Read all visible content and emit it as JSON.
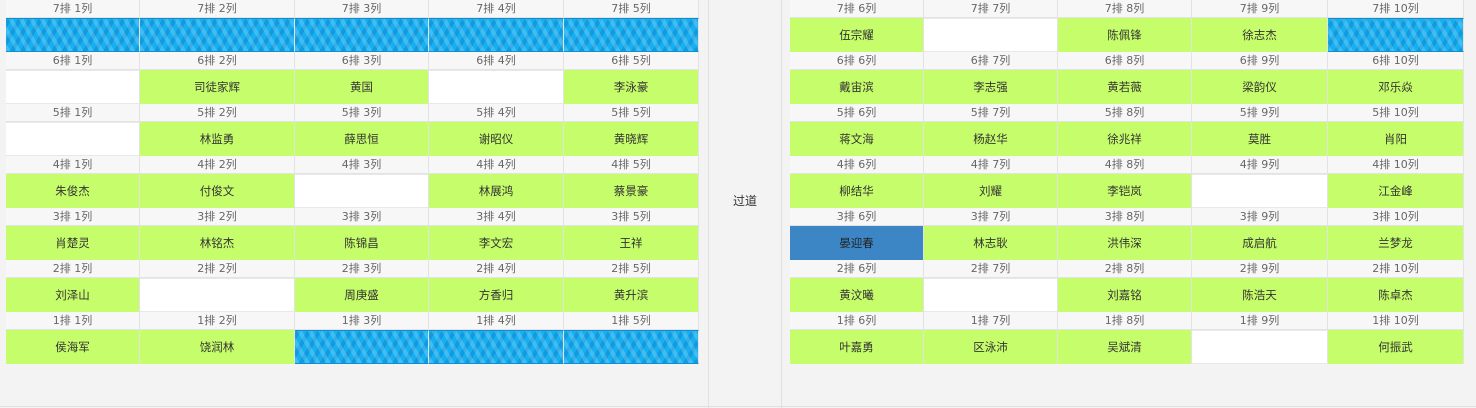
{
  "aisle": {
    "label": "过道"
  },
  "left": {
    "rows": [
      {
        "labels": [
          "7排 1列",
          "7排 2列",
          "7排 3列",
          "7排 4列",
          "7排 5列"
        ],
        "seats": [
          {
            "s": "blocked",
            "n": ""
          },
          {
            "s": "blocked",
            "n": ""
          },
          {
            "s": "blocked",
            "n": ""
          },
          {
            "s": "blocked",
            "n": ""
          },
          {
            "s": "blocked",
            "n": ""
          }
        ]
      },
      {
        "labels": [
          "6排 1列",
          "6排 2列",
          "6排 3列",
          "6排 4列",
          "6排 5列"
        ],
        "seats": [
          {
            "s": "empty",
            "n": ""
          },
          {
            "s": "occupied",
            "n": "司徒家辉"
          },
          {
            "s": "occupied",
            "n": "黄国"
          },
          {
            "s": "empty",
            "n": ""
          },
          {
            "s": "occupied",
            "n": "李泳豪"
          }
        ]
      },
      {
        "labels": [
          "5排 1列",
          "5排 2列",
          "5排 3列",
          "5排 4列",
          "5排 5列"
        ],
        "seats": [
          {
            "s": "empty",
            "n": ""
          },
          {
            "s": "occupied",
            "n": "林监勇"
          },
          {
            "s": "occupied",
            "n": "薛思恒"
          },
          {
            "s": "occupied",
            "n": "谢昭仪"
          },
          {
            "s": "occupied",
            "n": "黄晓辉"
          }
        ]
      },
      {
        "labels": [
          "4排 1列",
          "4排 2列",
          "4排 3列",
          "4排 4列",
          "4排 5列"
        ],
        "seats": [
          {
            "s": "occupied",
            "n": "朱俊杰"
          },
          {
            "s": "occupied",
            "n": "付俊文"
          },
          {
            "s": "empty",
            "n": ""
          },
          {
            "s": "occupied",
            "n": "林展鸿"
          },
          {
            "s": "occupied",
            "n": "蔡景豪"
          }
        ]
      },
      {
        "labels": [
          "3排 1列",
          "3排 2列",
          "3排 3列",
          "3排 4列",
          "3排 5列"
        ],
        "seats": [
          {
            "s": "occupied",
            "n": "肖楚灵"
          },
          {
            "s": "occupied",
            "n": "林铭杰"
          },
          {
            "s": "occupied",
            "n": "陈锦昌"
          },
          {
            "s": "occupied",
            "n": "李文宏"
          },
          {
            "s": "occupied",
            "n": "王祥"
          }
        ]
      },
      {
        "labels": [
          "2排 1列",
          "2排 2列",
          "2排 3列",
          "2排 4列",
          "2排 5列"
        ],
        "seats": [
          {
            "s": "occupied",
            "n": "刘泽山"
          },
          {
            "s": "empty",
            "n": ""
          },
          {
            "s": "occupied",
            "n": "周庚盛"
          },
          {
            "s": "occupied",
            "n": "方香归"
          },
          {
            "s": "occupied",
            "n": "黄升滨"
          }
        ]
      },
      {
        "labels": [
          "1排 1列",
          "1排 2列",
          "1排 3列",
          "1排 4列",
          "1排 5列"
        ],
        "seats": [
          {
            "s": "occupied",
            "n": "侯海军"
          },
          {
            "s": "occupied",
            "n": "饶润林"
          },
          {
            "s": "blocked",
            "n": ""
          },
          {
            "s": "blocked",
            "n": ""
          },
          {
            "s": "blocked",
            "n": ""
          }
        ]
      }
    ]
  },
  "right": {
    "rows": [
      {
        "labels": [
          "7排 6列",
          "7排 7列",
          "7排 8列",
          "7排 9列",
          "7排 10列"
        ],
        "seats": [
          {
            "s": "occupied",
            "n": "伍宗耀"
          },
          {
            "s": "empty",
            "n": ""
          },
          {
            "s": "occupied",
            "n": "陈佩锋"
          },
          {
            "s": "occupied",
            "n": "徐志杰"
          },
          {
            "s": "blocked",
            "n": ""
          }
        ]
      },
      {
        "labels": [
          "6排 6列",
          "6排 7列",
          "6排 8列",
          "6排 9列",
          "6排 10列"
        ],
        "seats": [
          {
            "s": "occupied",
            "n": "戴宙滨"
          },
          {
            "s": "occupied",
            "n": "李志强"
          },
          {
            "s": "occupied",
            "n": "黄若薇"
          },
          {
            "s": "occupied",
            "n": "梁韵仪"
          },
          {
            "s": "occupied",
            "n": "邓乐焱"
          }
        ]
      },
      {
        "labels": [
          "5排 6列",
          "5排 7列",
          "5排 8列",
          "5排 9列",
          "5排 10列"
        ],
        "seats": [
          {
            "s": "occupied",
            "n": "蒋文海"
          },
          {
            "s": "occupied",
            "n": "杨赵华"
          },
          {
            "s": "occupied",
            "n": "徐兆祥"
          },
          {
            "s": "occupied",
            "n": "莫胜"
          },
          {
            "s": "occupied",
            "n": "肖阳"
          }
        ]
      },
      {
        "labels": [
          "4排 6列",
          "4排 7列",
          "4排 8列",
          "4排 9列",
          "4排 10列"
        ],
        "seats": [
          {
            "s": "occupied",
            "n": "柳结华"
          },
          {
            "s": "occupied",
            "n": "刘耀"
          },
          {
            "s": "occupied",
            "n": "李铠岚"
          },
          {
            "s": "empty",
            "n": ""
          },
          {
            "s": "occupied",
            "n": "江金峰"
          }
        ]
      },
      {
        "labels": [
          "3排 6列",
          "3排 7列",
          "3排 8列",
          "3排 9列",
          "3排 10列"
        ],
        "seats": [
          {
            "s": "selected",
            "n": "晏迎春"
          },
          {
            "s": "occupied",
            "n": "林志耿"
          },
          {
            "s": "occupied",
            "n": "洪伟深"
          },
          {
            "s": "occupied",
            "n": "成启航"
          },
          {
            "s": "occupied",
            "n": "兰梦龙"
          }
        ]
      },
      {
        "labels": [
          "2排 6列",
          "2排 7列",
          "2排 8列",
          "2排 9列",
          "2排 10列"
        ],
        "seats": [
          {
            "s": "occupied",
            "n": "黄汶曦"
          },
          {
            "s": "empty",
            "n": ""
          },
          {
            "s": "occupied",
            "n": "刘嘉铭"
          },
          {
            "s": "occupied",
            "n": "陈浩天"
          },
          {
            "s": "occupied",
            "n": "陈卓杰"
          }
        ]
      },
      {
        "labels": [
          "1排 6列",
          "1排 7列",
          "1排 8列",
          "1排 9列",
          "1排 10列"
        ],
        "seats": [
          {
            "s": "occupied",
            "n": "叶嘉勇"
          },
          {
            "s": "occupied",
            "n": "区泳沛"
          },
          {
            "s": "occupied",
            "n": "吴斌清"
          },
          {
            "s": "empty",
            "n": ""
          },
          {
            "s": "occupied",
            "n": "何振武"
          }
        ]
      }
    ]
  }
}
